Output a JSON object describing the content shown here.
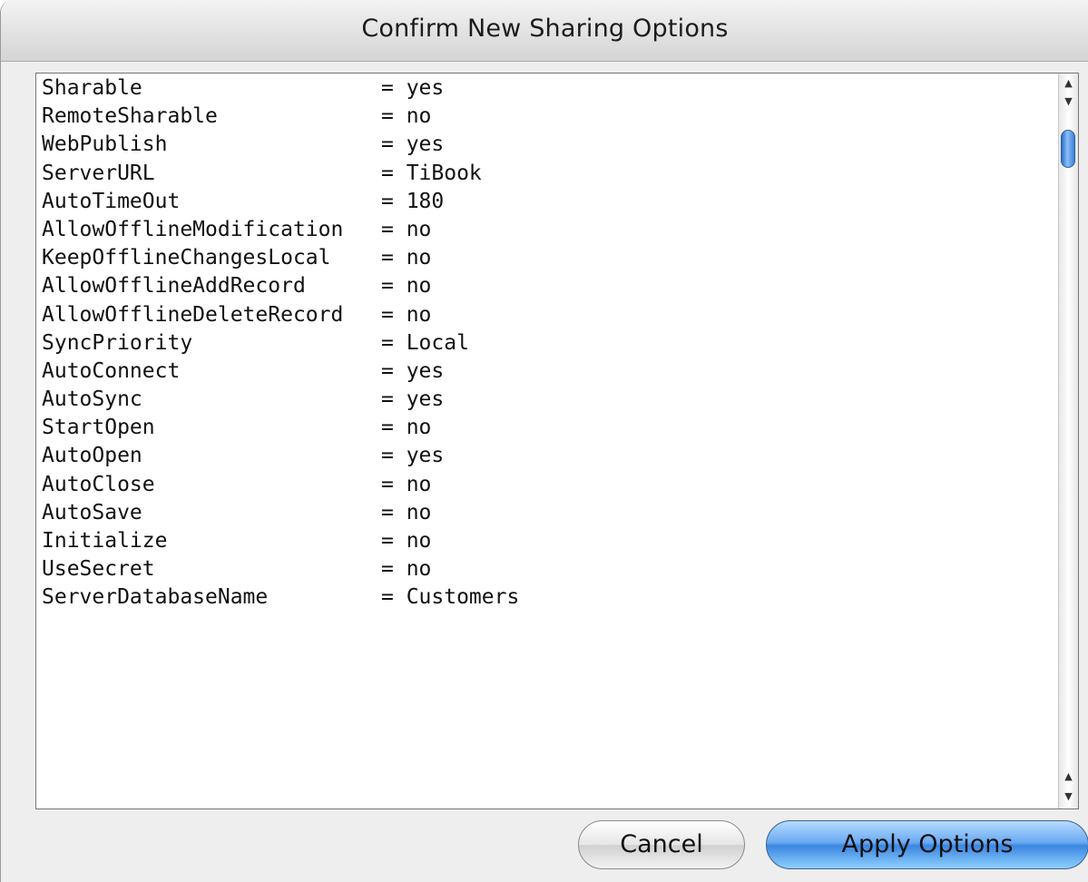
{
  "dialog": {
    "title": "Confirm New Sharing Options"
  },
  "options": [
    {
      "key": "Sharable",
      "value": "= yes"
    },
    {
      "key": "RemoteSharable",
      "value": "= no"
    },
    {
      "key": "WebPublish",
      "value": "= yes"
    },
    {
      "key": "ServerURL",
      "value": "= TiBook"
    },
    {
      "key": "AutoTimeOut",
      "value": "= 180"
    },
    {
      "key": "AllowOfflineModification",
      "value": "= no"
    },
    {
      "key": "KeepOfflineChangesLocal",
      "value": "= no"
    },
    {
      "key": "AllowOfflineAddRecord",
      "value": "= no"
    },
    {
      "key": "AllowOfflineDeleteRecord",
      "value": "= no"
    },
    {
      "key": "SyncPriority",
      "value": "= Local"
    },
    {
      "key": "AutoConnect",
      "value": "= yes"
    },
    {
      "key": "AutoSync",
      "value": "= yes"
    },
    {
      "key": "StartOpen",
      "value": "= no"
    },
    {
      "key": "AutoOpen",
      "value": "= yes"
    },
    {
      "key": "AutoClose",
      "value": "= no"
    },
    {
      "key": "AutoSave",
      "value": "= no"
    },
    {
      "key": "Initialize",
      "value": "= no"
    },
    {
      "key": "UseSecret",
      "value": "= no"
    },
    {
      "key": "ServerDatabaseName",
      "value": "= Customers"
    }
  ],
  "scrollbar": {
    "up_arrow_icon": "arrow-up-icon",
    "down_arrow_icon": "arrow-down-icon"
  },
  "buttons": {
    "cancel_label": "Cancel",
    "apply_label": "Apply Options"
  },
  "colors": {
    "accent": "#3b86e0",
    "thumb": "#2a6ec9"
  }
}
